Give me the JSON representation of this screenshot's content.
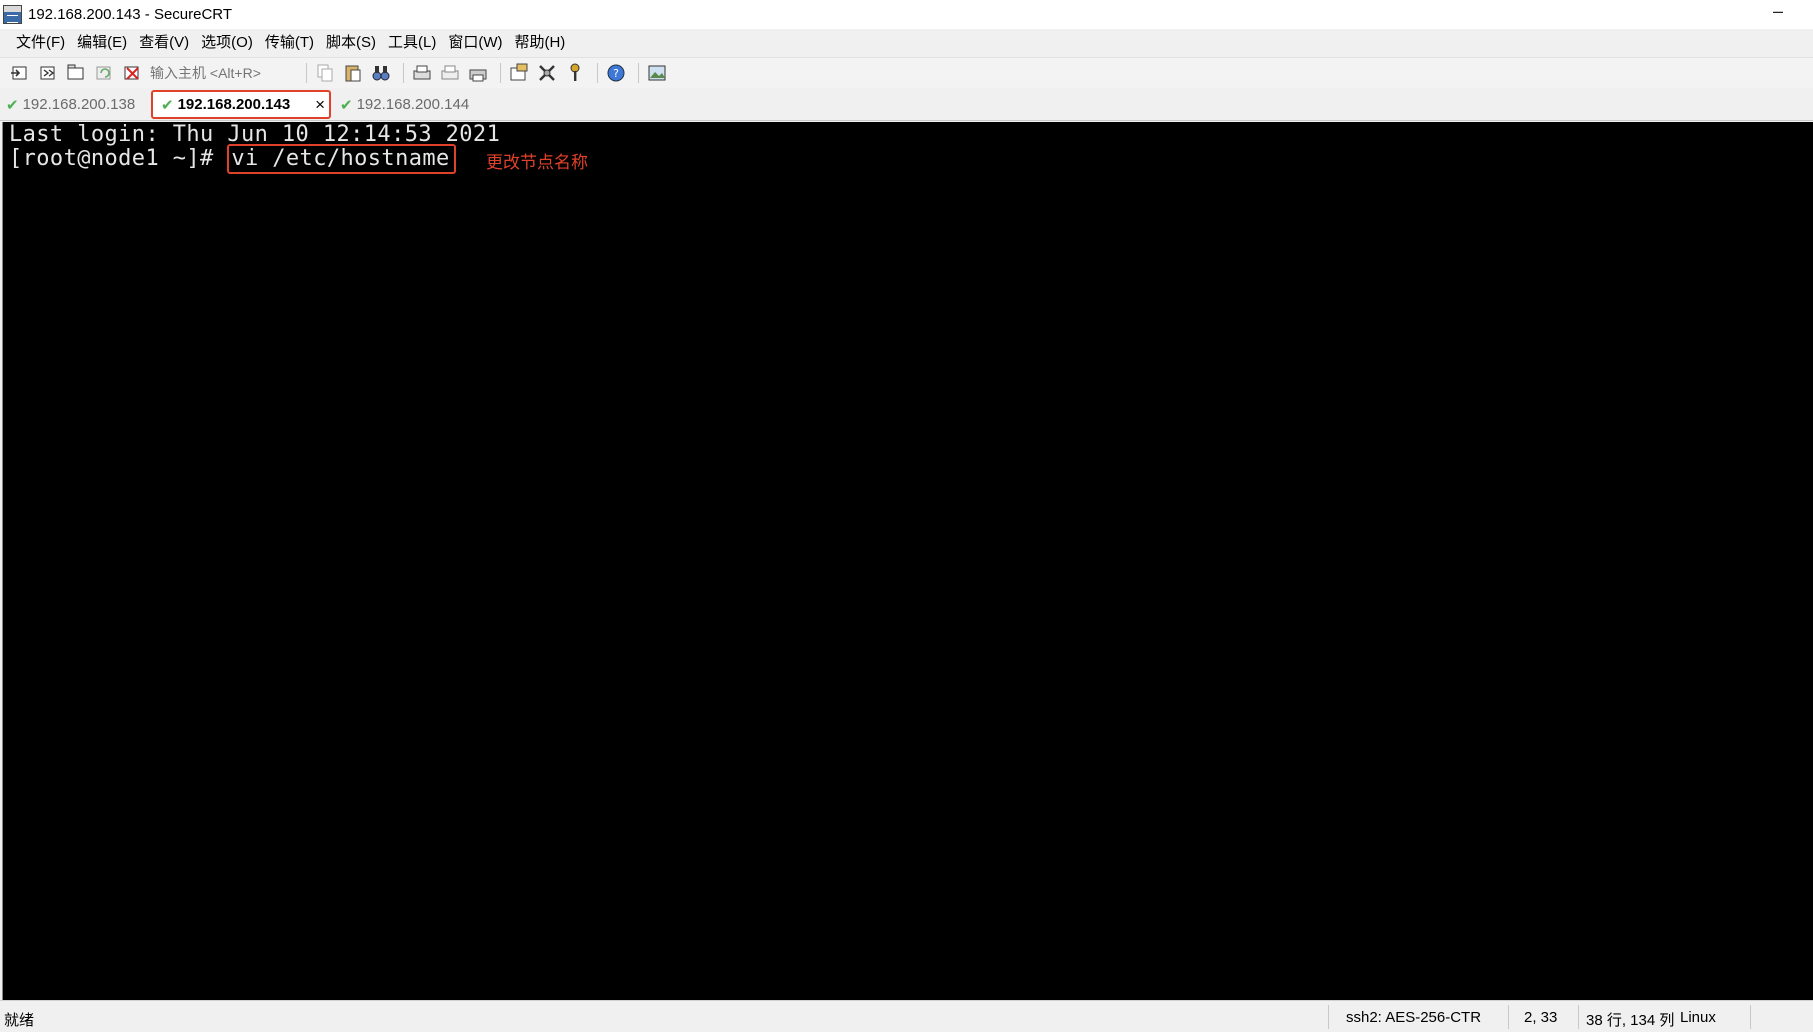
{
  "window": {
    "title": "192.168.200.143 - SecureCRT",
    "minimize": "–"
  },
  "menu": [
    "文件(F)",
    "编辑(E)",
    "查看(V)",
    "选项(O)",
    "传输(T)",
    "脚本(S)",
    "工具(L)",
    "窗口(W)",
    "帮助(H)"
  ],
  "toolbar": {
    "quick_connect_placeholder": "输入主机 <Alt+R>"
  },
  "tabs": [
    {
      "label": "192.168.200.138",
      "active": false
    },
    {
      "label": "192.168.200.143",
      "active": true,
      "close": "×"
    },
    {
      "label": "192.168.200.144",
      "active": false
    }
  ],
  "terminal": {
    "line1": "Last login: Thu Jun 10 12:14:53 2021",
    "prompt": "[root@node1 ~]# ",
    "command": "vi /etc/hostname",
    "annotation": "更改节点名称"
  },
  "status": {
    "ready": "就绪",
    "encryption": "ssh2: AES-256-CTR",
    "cursor": "2,  33",
    "size": "38 行, 134 列",
    "os": "Linux"
  },
  "colors": {
    "highlight": "#e0412a",
    "terminal_bg": "#000000",
    "terminal_fg": "#e6e6e6",
    "connected_check": "#4caf50"
  }
}
